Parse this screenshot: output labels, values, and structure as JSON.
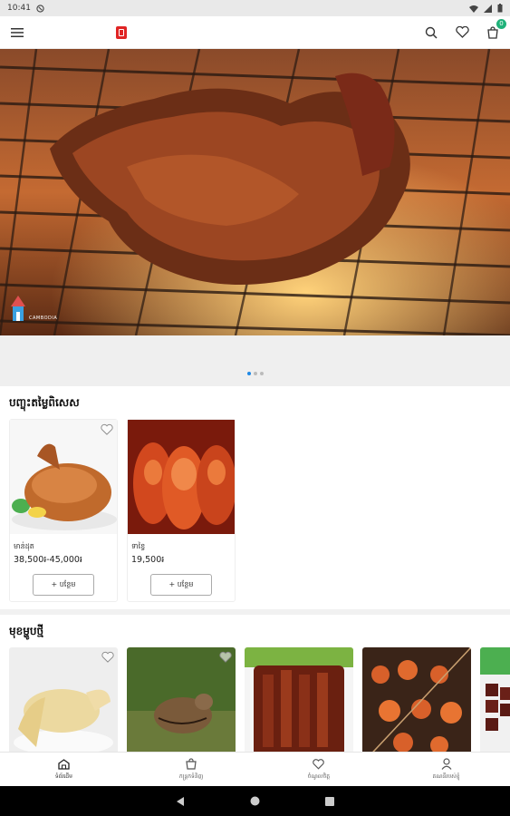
{
  "status_bar": {
    "time": "10:41"
  },
  "header": {
    "cart_badge": "0"
  },
  "hero": {
    "brand_text": "CAMBODIA",
    "page_indicator": {
      "count": 3,
      "active": 0
    }
  },
  "featured": {
    "title": "បញ្ចុះតម្លៃពិសេស",
    "items": [
      {
        "name": "មាន់ដុត",
        "price": "38,500៛-45,000៛",
        "button": "+ បន្ថែម"
      },
      {
        "name": "ទាខ្វៃ",
        "price": "19,500៛",
        "button": "+ បន្ថែម"
      }
    ]
  },
  "new_items": {
    "title": "មុខម្ហូបថ្មី"
  },
  "bottom_nav": [
    {
      "label": "ទំព័រដើម"
    },
    {
      "label": "កន្ត្រកទំនិញ"
    },
    {
      "label": "ចំណូលចិត្ត"
    },
    {
      "label": "គណនីរបស់ខ្ញុំ"
    }
  ],
  "colors": {
    "accent": "#1e88e5",
    "brand": "#e02424",
    "badge": "#20b27a"
  }
}
